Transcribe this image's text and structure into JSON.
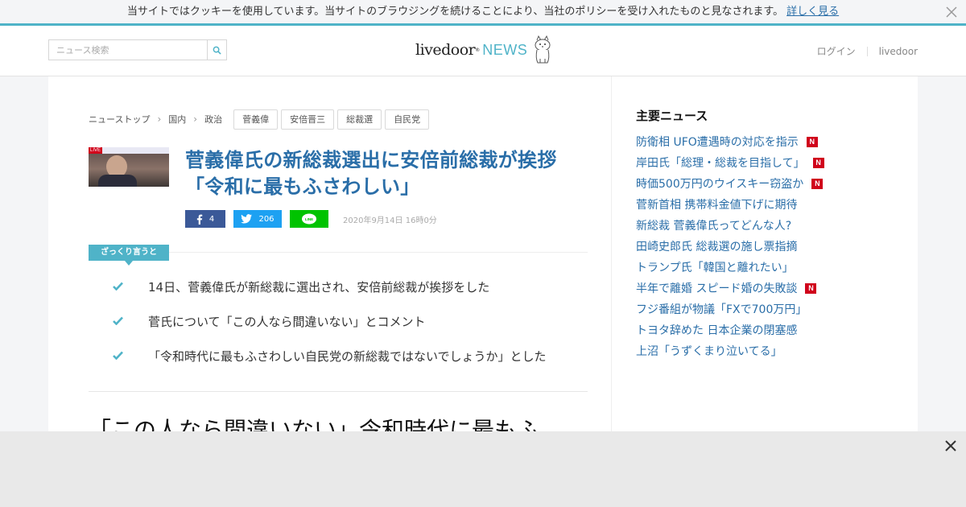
{
  "cookie_bar": {
    "text": "当サイトではクッキーを使用しています。当サイトのブラウジングを続けることにより、当社のポリシーを受け入れたものと見なされます。",
    "link_label": "詳しく見る",
    "close_icon": "close-icon"
  },
  "header": {
    "search_placeholder": "ニュース検索",
    "search_icon": "search-icon",
    "logo_main": "livedoor",
    "logo_reg": "®",
    "logo_news": "NEWS",
    "logo_icon": "dog-mascot-icon",
    "login_label": "ログイン",
    "livedoor_label": "livedoor"
  },
  "breadcrumb": [
    "ニューストップ",
    "国内",
    "政治"
  ],
  "tags": [
    "菅義偉",
    "安倍晋三",
    "総裁選",
    "自民党"
  ],
  "article": {
    "title": "菅義偉氏の新総裁選出に安倍前総裁が挨拶「令和に最もふさわしい」",
    "thumb_live": "LIVE",
    "share": {
      "facebook_count": "4",
      "twitter_count": "206",
      "line_label": "LINE"
    },
    "date": "2020年9月14日 16時0分",
    "summary_label": "ざっくり言うと",
    "summary": [
      "14日、菅義偉氏が新総裁に選出され、安倍前総裁が挨拶をした",
      "菅氏について「この人なら間違いない」とコメント",
      "「令和時代に最もふさわしい自民党の新総裁ではないでしょうか」とした"
    ],
    "subheading": "「この人なら間違いない」令和時代に最もふ"
  },
  "sidebar": {
    "heading": "主要ニュース",
    "items": [
      {
        "label": "防衛相 UFO遭遇時の対応を指示",
        "badge": "N"
      },
      {
        "label": "岸田氏「総理・総裁を目指して」",
        "badge": "N"
      },
      {
        "label": "時価500万円のウイスキー窃盗か",
        "badge": "N"
      },
      {
        "label": "菅新首相 携帯料金値下げに期待",
        "badge": ""
      },
      {
        "label": "新総裁 菅義偉氏ってどんな人?",
        "badge": ""
      },
      {
        "label": "田崎史郎氏 総裁選の施し票指摘",
        "badge": ""
      },
      {
        "label": "トランプ氏「韓国と離れたい」",
        "badge": ""
      },
      {
        "label": "半年で離婚 スピード婚の失敗談",
        "badge": "N"
      },
      {
        "label": "フジ番組が物議「FXで700万円」",
        "badge": ""
      },
      {
        "label": "トヨタ辞めた 日本企業の閉塞感",
        "badge": ""
      },
      {
        "label": "上沼「うずくまり泣いてる」",
        "badge": ""
      }
    ]
  },
  "colors": {
    "accent": "#4fb3c8",
    "link": "#2a6ea8",
    "facebook": "#3b5998",
    "twitter": "#1da1f2",
    "line": "#00c300",
    "new_badge": "#d0021b"
  }
}
